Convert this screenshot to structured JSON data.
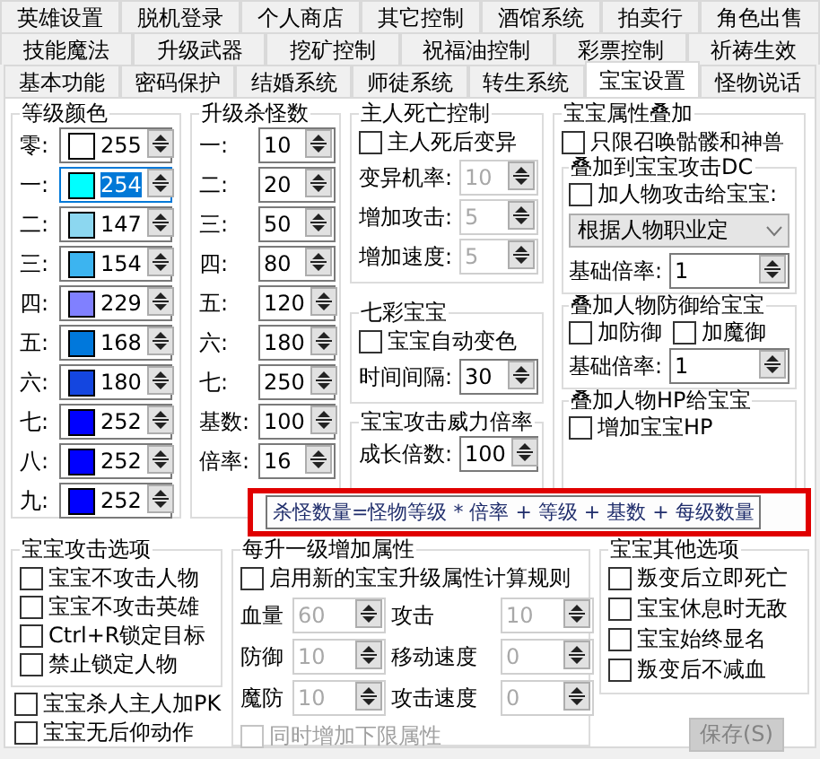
{
  "tabs": [
    [
      {
        "label": "英雄设置",
        "selected": false
      },
      {
        "label": "脱机登录",
        "selected": false
      },
      {
        "label": "个人商店",
        "selected": false
      },
      {
        "label": "其它控制",
        "selected": false
      },
      {
        "label": "酒馆系统",
        "selected": false
      },
      {
        "label": "拍卖行",
        "selected": false
      },
      {
        "label": "角色出售",
        "selected": false
      }
    ],
    [
      {
        "label": "技能魔法",
        "selected": false
      },
      {
        "label": "升级武器",
        "selected": false
      },
      {
        "label": "挖矿控制",
        "selected": false
      },
      {
        "label": "祝福油控制",
        "selected": false
      },
      {
        "label": "彩票控制",
        "selected": false
      },
      {
        "label": "祈祷生效",
        "selected": false
      }
    ],
    [
      {
        "label": "基本功能",
        "selected": false
      },
      {
        "label": "密码保护",
        "selected": false
      },
      {
        "label": "结婚系统",
        "selected": false
      },
      {
        "label": "师徒系统",
        "selected": false
      },
      {
        "label": "转生系统",
        "selected": false
      },
      {
        "label": "宝宝设置",
        "selected": true
      },
      {
        "label": "怪物说话",
        "selected": false
      }
    ]
  ],
  "level_colors": {
    "title": "等级颜色",
    "rows": [
      {
        "label": "零:",
        "color": "#ffffff",
        "value": "255",
        "focused": false
      },
      {
        "label": "一:",
        "color": "#00ffff",
        "value": "254",
        "focused": true
      },
      {
        "label": "二:",
        "color": "#8cd7f0",
        "value": "147",
        "focused": false
      },
      {
        "label": "三:",
        "color": "#3cb4f0",
        "value": "154",
        "focused": false
      },
      {
        "label": "四:",
        "color": "#8080ff",
        "value": "229",
        "focused": false
      },
      {
        "label": "五:",
        "color": "#0078dc",
        "value": "168",
        "focused": false
      },
      {
        "label": "六:",
        "color": "#1446e0",
        "value": "180",
        "focused": false
      },
      {
        "label": "七:",
        "color": "#0000ff",
        "value": "252",
        "focused": false
      },
      {
        "label": "八:",
        "color": "#0000ff",
        "value": "252",
        "focused": false
      },
      {
        "label": "九:",
        "color": "#0000ff",
        "value": "252",
        "focused": false
      }
    ]
  },
  "kill_counts": {
    "title": "升级杀怪数",
    "rows": [
      {
        "label": "一:",
        "value": "10"
      },
      {
        "label": "二:",
        "value": "20"
      },
      {
        "label": "三:",
        "value": "50"
      },
      {
        "label": "四:",
        "value": "80"
      },
      {
        "label": "五:",
        "value": "120"
      },
      {
        "label": "六:",
        "value": "180"
      },
      {
        "label": "七:",
        "value": "250"
      },
      {
        "label": "基数:",
        "value": "100"
      },
      {
        "label": "倍率:",
        "value": "16"
      }
    ]
  },
  "owner_death": {
    "title": "主人死亡控制",
    "checkbox": {
      "label": "主人死后变异",
      "checked": false
    },
    "fields": [
      {
        "label": "变异机率:",
        "value": "10",
        "disabled": true
      },
      {
        "label": "增加攻击:",
        "value": "5",
        "disabled": true
      },
      {
        "label": "增加速度:",
        "value": "5",
        "disabled": true
      }
    ]
  },
  "rainbow": {
    "title": "七彩宝宝",
    "checkbox": {
      "label": "宝宝自动变色",
      "checked": false
    },
    "field": {
      "label": "时间间隔:",
      "value": "30",
      "disabled": false
    }
  },
  "attack_power": {
    "title": "宝宝攻击威力倍率",
    "field": {
      "label": "成长倍数:",
      "value": "100",
      "disabled": false
    }
  },
  "attr_stack": {
    "title": "宝宝属性叠加",
    "checkbox": {
      "label": "只限召唤骷髅和神兽",
      "checked": false
    },
    "sections": [
      {
        "title": "叠加到宝宝攻击DC",
        "checkboxes": [
          {
            "label": "加人物攻击给宝宝:",
            "checked": false
          }
        ],
        "dropdown": "根据人物职业定",
        "field": {
          "label": "基础倍率:",
          "value": "1",
          "disabled": false
        }
      },
      {
        "title": "叠加人物防御给宝宝",
        "checkboxes": [
          {
            "label": "加防御",
            "checked": false
          },
          {
            "label": "加魔御",
            "checked": false
          }
        ],
        "field": {
          "label": "基础倍率:",
          "value": "1",
          "disabled": false
        }
      },
      {
        "title": "叠加人物HP给宝宝",
        "checkboxes": [
          {
            "label": "增加宝宝HP",
            "checked": false
          }
        ]
      }
    ]
  },
  "attack_options": {
    "title": "宝宝攻击选项",
    "checkboxes": [
      {
        "label": "宝宝不攻击人物",
        "checked": false
      },
      {
        "label": "宝宝不攻击英雄",
        "checked": false
      },
      {
        "label": "Ctrl+R锁定目标",
        "checked": false
      },
      {
        "label": "禁止锁定人物",
        "checked": false
      }
    ]
  },
  "extra_checkboxes": [
    {
      "label": "宝宝杀人主人加PK",
      "checked": false
    },
    {
      "label": "宝宝无后仰动作",
      "checked": false
    }
  ],
  "level_up": {
    "title": "每升一级增加属性",
    "checkbox": {
      "label": "启用新的宝宝升级属性计算规则",
      "checked": false
    },
    "fields": [
      {
        "label": "血量",
        "value": "60",
        "disabled": true
      },
      {
        "label": "攻击",
        "value": "10",
        "disabled": true
      },
      {
        "label": "防御",
        "value": "10",
        "disabled": true
      },
      {
        "label": "移动速度",
        "value": "0",
        "disabled": true
      },
      {
        "label": "魔防",
        "value": "10",
        "disabled": true
      },
      {
        "label": "攻击速度",
        "value": "0",
        "disabled": true
      }
    ],
    "bottom_checkbox": {
      "label": "同时增加下限属性",
      "checked": false,
      "disabled": true
    }
  },
  "other_options": {
    "title": "宝宝其他选项",
    "checkboxes": [
      {
        "label": "叛变后立即死亡",
        "checked": false
      },
      {
        "label": "宝宝休息时无敌",
        "checked": false
      },
      {
        "label": "宝宝始终显名",
        "checked": false
      },
      {
        "label": "叛变后不减血",
        "checked": false
      }
    ]
  },
  "save_button": {
    "label": "保存(S)",
    "disabled": true
  },
  "tooltip": "杀怪数量=怪物等级 * 倍率 + 等级 + 基数 + 每级数量"
}
